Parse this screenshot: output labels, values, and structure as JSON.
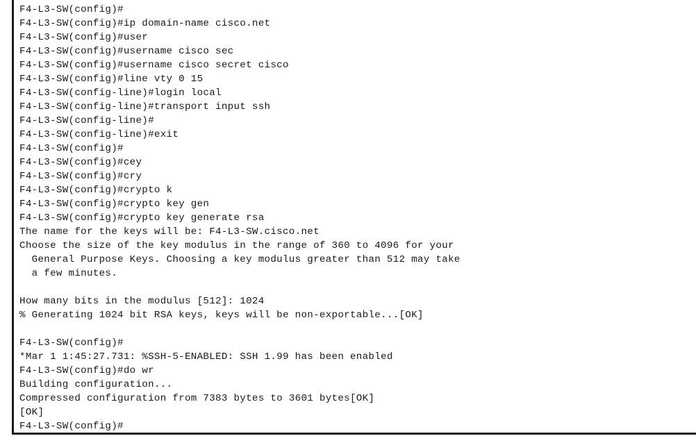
{
  "terminal": {
    "lines": [
      "F4-L3-SW(config)#",
      "F4-L3-SW(config)#ip domain-name cisco.net",
      "F4-L3-SW(config)#user",
      "F4-L3-SW(config)#username cisco sec",
      "F4-L3-SW(config)#username cisco secret cisco",
      "F4-L3-SW(config)#line vty 0 15",
      "F4-L3-SW(config-line)#login local",
      "F4-L3-SW(config-line)#transport input ssh",
      "F4-L3-SW(config-line)#",
      "F4-L3-SW(config-line)#exit",
      "F4-L3-SW(config)#",
      "F4-L3-SW(config)#cey",
      "F4-L3-SW(config)#cry",
      "F4-L3-SW(config)#crypto k",
      "F4-L3-SW(config)#crypto key gen",
      "F4-L3-SW(config)#crypto key generate rsa",
      "The name for the keys will be: F4-L3-SW.cisco.net",
      "Choose the size of the key modulus in the range of 360 to 4096 for your",
      "  General Purpose Keys. Choosing a key modulus greater than 512 may take",
      "  a few minutes.",
      "",
      "How many bits in the modulus [512]: 1024",
      "% Generating 1024 bit RSA keys, keys will be non-exportable...[OK]",
      "",
      "F4-L3-SW(config)#",
      "*Mar 1 1:45:27.731: %SSH-5-ENABLED: SSH 1.99 has been enabled",
      "F4-L3-SW(config)#do wr",
      "Building configuration...",
      "Compressed configuration from 7383 bytes to 3601 bytes[OK]",
      "[OK]",
      "F4-L3-SW(config)#"
    ]
  }
}
